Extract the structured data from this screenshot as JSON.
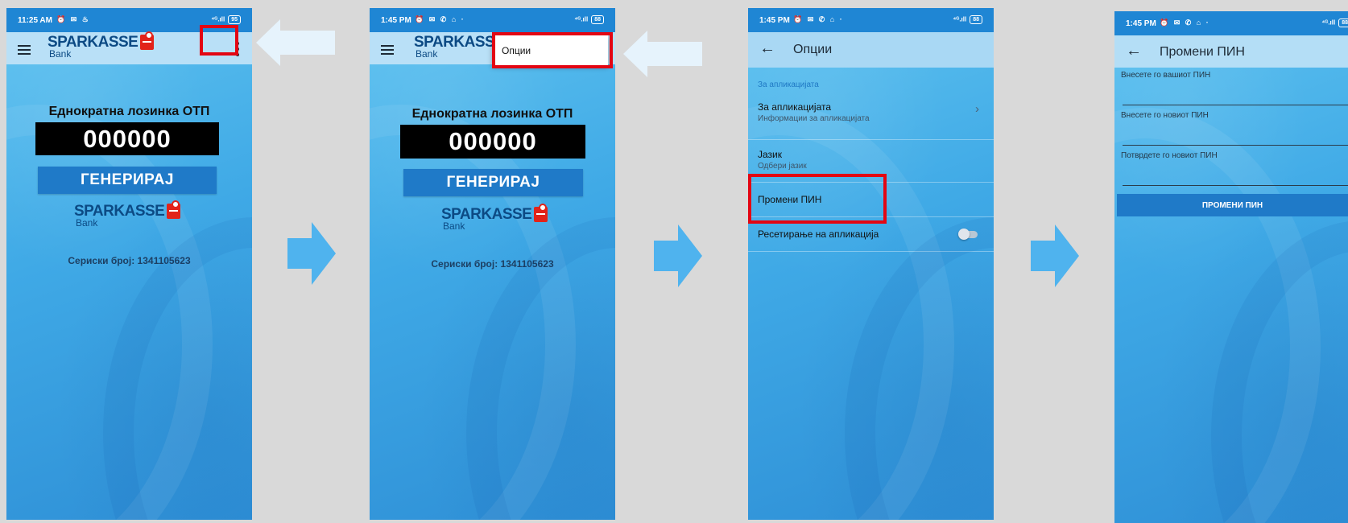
{
  "screens": {
    "home": {
      "status": {
        "time": "11:25 AM",
        "icons": "⏰ ✉ ♨",
        "signal": "⁴ᴳ.ıll",
        "battery": "95"
      },
      "logo": {
        "brand": "SPARKASSE",
        "sub": "Bank"
      },
      "otp_title": "Еднократна лозинка ОТП",
      "otp_code": "000000",
      "generate_label": "ГЕНЕРИРАЈ",
      "serial": "Сериски број: 1341105623"
    },
    "menu_open": {
      "status": {
        "time": "1:45 PM",
        "icons": "⏰ ✉ ✆ ⌂ ·",
        "signal": "⁴ᴳ.ıll",
        "battery": "88"
      },
      "logo": {
        "brand": "SPARKASS",
        "sub": "Bank"
      },
      "popup_item": "Опции",
      "otp_title": "Еднократна лозинка ОТП",
      "otp_code": "000000",
      "generate_label": "ГЕНЕРИРАЈ",
      "serial": "Сериски број: 1341105623"
    },
    "options": {
      "status": {
        "time": "1:45 PM",
        "icons": "⏰ ✉ ✆ ⌂ ·",
        "signal": "⁴ᴳ.ıll",
        "battery": "88"
      },
      "title": "Опции",
      "section": "За апликацијата",
      "items": [
        {
          "title": "За апликацијата",
          "subtitle": "Информации за апликацијата"
        },
        {
          "title": "Јазик",
          "subtitle": "Одбери јазик"
        },
        {
          "title": "Промени ПИН",
          "subtitle": ""
        },
        {
          "title": "Ресетирање на апликација",
          "subtitle": ""
        }
      ]
    },
    "change_pin": {
      "status": {
        "time": "1:45 PM",
        "icons": "⏰ ✉ ✆ ⌂ ·",
        "signal": "⁴ᴳ.ıll",
        "battery": "88"
      },
      "title": "Промени ПИН",
      "fields": [
        "Внесете го вашиот ПИН",
        "Внесете го новиот ПИН",
        "Потврдете го новиот ПИН"
      ],
      "button_label": "ПРОМЕНИ ПИН"
    }
  },
  "colors": {
    "highlight": "#e30613",
    "arrow": "#4fb3ee",
    "pointer_arrow": "#e6f3fc"
  }
}
